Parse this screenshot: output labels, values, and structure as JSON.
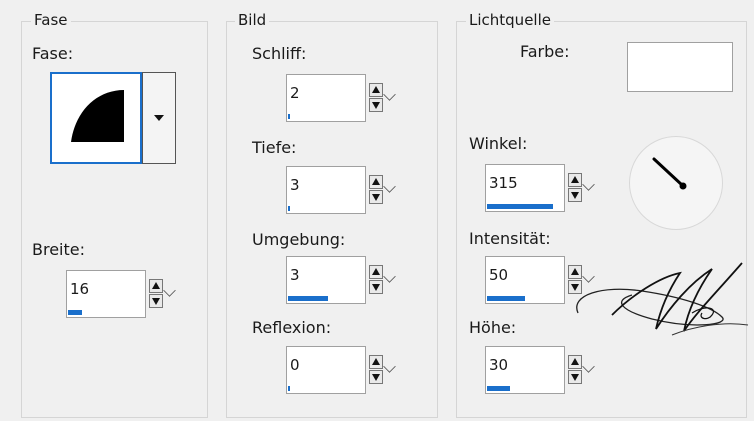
{
  "groups": {
    "fase": {
      "legend": "Fase",
      "fase_label": "Fase:",
      "breite_label": "Breite:",
      "breite": {
        "value": "16",
        "level": 0.18
      }
    },
    "bild": {
      "legend": "Bild",
      "schliff": {
        "label": "Schliff:",
        "value": "2",
        "level": 0.02
      },
      "tiefe": {
        "label": "Tiefe:",
        "value": "3",
        "level": 0.02
      },
      "umgebung": {
        "label": "Umgebung:",
        "value": "3",
        "level": 0.53
      },
      "reflexion": {
        "label": "Reflexion:",
        "value": "0",
        "level": 0.0
      }
    },
    "lichtquelle": {
      "legend": "Lichtquelle",
      "farbe_label": "Farbe:",
      "farbe_color": "#ffffff",
      "winkel": {
        "label": "Winkel:",
        "value": "315",
        "level": 0.87
      },
      "intensitaet": {
        "label": "Intensität:",
        "value": "50",
        "level": 0.5
      },
      "hoehe": {
        "label": "Höhe:",
        "value": "30",
        "level": 0.3
      }
    }
  },
  "colors": {
    "accent": "#1a6fcb",
    "background": "#f0f0f0",
    "border": "#d5d5d5"
  },
  "icons": {
    "bevel_preview": "quarter-round-bevel-icon",
    "dropdown": "dropdown-arrow-icon",
    "spinner": "spinner-arrows-icon",
    "dial": "angle-dial-icon",
    "watermark": "signature-watermark"
  }
}
